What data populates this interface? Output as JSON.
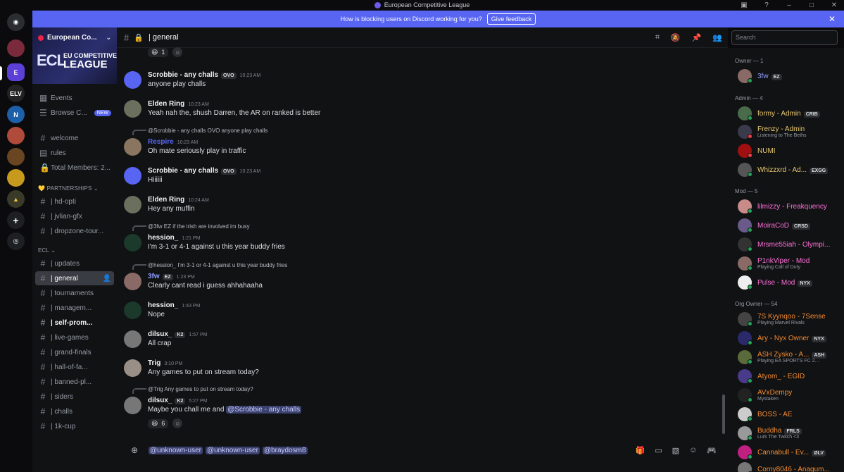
{
  "window": {
    "title": "European Competitive League"
  },
  "banner": {
    "text": "How is blocking users on Discord working for you?",
    "button": "Give feedback"
  },
  "server": {
    "name": "European Co...",
    "banner_big": "ECL",
    "banner_sub1": "EU COMPETITIVE",
    "banner_sub2": "LEAGUE"
  },
  "channels": {
    "events": "Events",
    "browse": "Browse C...",
    "new_badge": "NEW",
    "welcome": "welcome",
    "rules": "rules",
    "members": "Total Members: 2...",
    "cat_partnerships": "PARTNERSHIPS",
    "hd": "| hd-opti",
    "jvlian": "| jvlian-gfx",
    "dropzone": "| dropzone-tour...",
    "cat_ecl": "ECL",
    "updates": "| updates",
    "general": "| general",
    "tournaments": "| tournaments",
    "management": "| managem...",
    "selfpromo": "| self-prom...",
    "livegames": "| live-games",
    "grandfinals": "| grand-finals",
    "hof": "| hall-of-fa...",
    "banned": "| banned-pl...",
    "siders": "| siders",
    "challs": "| challs",
    "onekcup": "| 1k-cup"
  },
  "header": {
    "channel": "| general",
    "search_placeholder": "Search"
  },
  "messages": [
    {
      "user": "Scrobbie - any challs",
      "tag": "OVO",
      "time": "10:23 AM",
      "text": "anyone play challs"
    },
    {
      "user": "Elden Ring",
      "time": "10:23 AM",
      "text": "Yeah nah the, shush Darren, the AR on ranked is better"
    },
    {
      "reply": "@Scrobbie - any challs  OVO  anyone play challs",
      "user": "Respire",
      "time": "10:23 AM",
      "text": "Oh mate seriously play in traffic"
    },
    {
      "user": "Scrobbie - any challs",
      "tag": "OVO",
      "time": "10:23 AM",
      "text": "Hiiiiii"
    },
    {
      "user": "Elden Ring",
      "time": "10:24 AM",
      "text": "Hey any muffin"
    },
    {
      "reply": "@3fw  EZ  if the irish are involved im busy",
      "user": "hession_",
      "time": "1:21 PM",
      "text": "I'm 3-1 or 4-1 against u this year buddy fries"
    },
    {
      "reply": "@hession_ I'm 3-1 or 4-1 against u this year buddy fries",
      "user": "3fw",
      "tag": "EZ",
      "time": "1:23 PM",
      "text": "Clearly cant read i guess ahhahaaha"
    },
    {
      "user": "hession_",
      "time": "1:43 PM",
      "text": "Nope"
    },
    {
      "user": "dilsux_",
      "tag": "K2",
      "time": "1:57 PM",
      "text": "All crap"
    },
    {
      "user": "Trig",
      "time": "3:10 PM",
      "text": "Any games to put on stream today?"
    },
    {
      "reply": "@Trig Any games to put on stream today?",
      "user": "dilsux_",
      "tag": "K2",
      "time": "5:27 PM",
      "text": "Maybe you chall me and",
      "mention": "@Scrobbie - any challs",
      "reaction": "6"
    }
  ],
  "top_reaction": "1",
  "composer": {
    "m1": "@unknown-user",
    "m2": "@unknown-user",
    "m3": "@braydosm8"
  },
  "member_list": {
    "owner_cat": "Owner — 1",
    "admin_cat": "Admin — 4",
    "mod_cat": "Mod — 5",
    "org_cat": "Org Owner — 54",
    "owner": [
      {
        "name": "3fw",
        "tag": "EZ"
      }
    ],
    "admins": [
      {
        "name": "formy - Admin",
        "tag": "CRIB"
      },
      {
        "name": "Frenzy - Admin",
        "sub": "Listening to The Beths"
      },
      {
        "name": "NUMI"
      },
      {
        "name": "Whizzxrd - Ad...",
        "tag": "EXGG"
      }
    ],
    "mods": [
      {
        "name": "lilmizzy - Freakquency"
      },
      {
        "name": "MoiraCoD",
        "tag": "CRSD"
      },
      {
        "name": "Mrsme55iah - Olympi..."
      },
      {
        "name": "P1nkViper - Mod",
        "sub": "Playing Call of Duty"
      },
      {
        "name": "Pulse - Mod",
        "tag": "NYX"
      }
    ],
    "org": [
      {
        "name": "7S Kyynqoo - 7Sense",
        "sub": "Playing Marvel Rivals"
      },
      {
        "name": "Ary - Nyx Owner",
        "tag": "NYX"
      },
      {
        "name": "ASH Zysko - A...",
        "tag": "ASH",
        "sub": "Playing EA SPORTS FC 2..."
      },
      {
        "name": "Atyom_ - EGID"
      },
      {
        "name": "AVxDempy",
        "sub": "Mystaken"
      },
      {
        "name": "BOSS - AE"
      },
      {
        "name": "Buddha",
        "tag": "FRLS",
        "sub": "Lurk The Twitch <3"
      },
      {
        "name": "Cannabull - Ev...",
        "tag": "ØLV"
      },
      {
        "name": "Corny8046 - Anagum..."
      }
    ]
  },
  "colors": {
    "accent": "#5865f2",
    "admin": "#e8c86e",
    "mod": "#ff6fd8",
    "org": "#f28a2e",
    "owner": "#8e9dff"
  }
}
